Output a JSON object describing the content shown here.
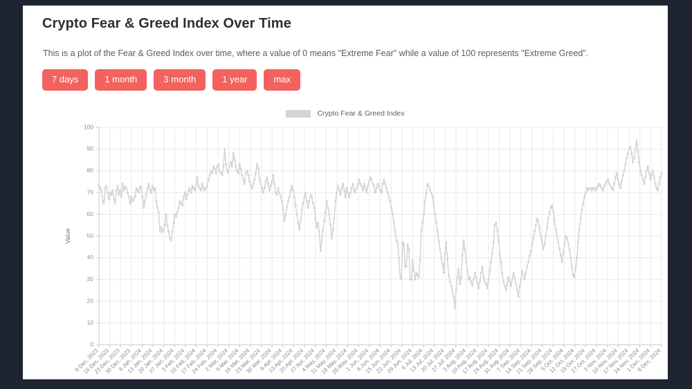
{
  "card": {
    "title": "Crypto Fear & Greed Index Over Time",
    "description": "This is a plot of the Fear & Greed Index over time, where a value of 0 means \"Extreme Fear\" while a value of 100 represents \"Extreme Greed\"."
  },
  "colors": {
    "page_background": "#1e2430",
    "card_background": "#ffffff",
    "button": "#f2635f",
    "button_text": "#ffffff",
    "series": "#d2d2d4",
    "grid": "#e9e9ec"
  },
  "range_buttons": [
    {
      "label": "7 days",
      "name": "range-button-7-days"
    },
    {
      "label": "1 month",
      "name": "range-button-1-month"
    },
    {
      "label": "3 month",
      "name": "range-button-3-month"
    },
    {
      "label": "1 year",
      "name": "range-button-1-year"
    },
    {
      "label": "max",
      "name": "range-button-max"
    }
  ],
  "legend": {
    "label": "Crypto Fear & Greed Index",
    "swatch_color": "#d4d4d4"
  },
  "chart_data": {
    "type": "line",
    "title": "Crypto Fear & Greed Index Over Time",
    "xlabel": "",
    "ylabel": "Value",
    "ylim": [
      0,
      100
    ],
    "yticks": [
      0,
      10,
      20,
      30,
      40,
      50,
      60,
      70,
      80,
      90,
      100
    ],
    "grid": true,
    "legend_position": "top-center",
    "series_name": "Crypto Fear & Greed Index",
    "x_tick_labels": [
      "9 Dec, 2023",
      "16 Dec, 2023",
      "23 Dec, 2023",
      "30 Dec, 2023",
      "6 Jan, 2024",
      "13 Jan, 2024",
      "20 Jan, 2024",
      "27 Jan, 2024",
      "3 Feb, 2024",
      "10 Feb, 2024",
      "17 Feb, 2024",
      "24 Feb, 2024",
      "2 Mar, 2024",
      "9 Mar, 2024",
      "16 Mar, 2024",
      "23 Mar, 2024",
      "30 Mar, 2024",
      "6 Apr, 2024",
      "13 Apr, 2024",
      "20 Apr, 2024",
      "27 Apr, 2024",
      "4 May, 2024",
      "11 May, 2024",
      "18 May, 2024",
      "25 May, 2024",
      "1 Jun, 2024",
      "8 Jun, 2024",
      "15 Jun, 2024",
      "22 Jun, 2024",
      "29 Jun, 2024",
      "6 Jul, 2024",
      "13 Jul, 2024",
      "20 Jul, 2024",
      "27 Jul, 2024",
      "3 Aug, 2024",
      "10 Aug, 2024",
      "17 Aug, 2024",
      "24 Aug, 2024",
      "31 Aug, 2024",
      "7 Sep, 2024",
      "14 Sep, 2024",
      "21 Sep, 2024",
      "28 Sep, 2024",
      "5 Oct, 2024",
      "12 Oct, 2024",
      "19 Oct, 2024",
      "27 Oct, 2024",
      "3 Nov, 2024",
      "10 Nov, 2024",
      "17 Nov, 2024",
      "24 Nov, 2024",
      "1 Dec, 2024",
      "8 Dec, 2024"
    ],
    "x_start": "9 Dec, 2023",
    "x_end": "8 Dec, 2024",
    "values": [
      73,
      72,
      71,
      66,
      65,
      72,
      73,
      70,
      67,
      70,
      69,
      71,
      67,
      65,
      71,
      73,
      69,
      71,
      68,
      74,
      71,
      73,
      72,
      70,
      68,
      65,
      68,
      66,
      67,
      68,
      72,
      71,
      70,
      73,
      72,
      68,
      63,
      66,
      69,
      72,
      74,
      71,
      70,
      73,
      71,
      72,
      66,
      63,
      61,
      52,
      54,
      52,
      53,
      55,
      60,
      55,
      52,
      49,
      48,
      52,
      56,
      60,
      59,
      61,
      63,
      66,
      65,
      64,
      68,
      70,
      67,
      69,
      71,
      72,
      70,
      73,
      72,
      71,
      74,
      77,
      73,
      72,
      71,
      74,
      72,
      71,
      72,
      73,
      76,
      78,
      80,
      79,
      82,
      81,
      79,
      82,
      83,
      80,
      79,
      78,
      82,
      90,
      83,
      80,
      79,
      82,
      84,
      82,
      88,
      85,
      82,
      80,
      79,
      83,
      81,
      78,
      76,
      74,
      79,
      80,
      78,
      75,
      73,
      72,
      74,
      76,
      79,
      83,
      81,
      76,
      74,
      72,
      70,
      72,
      75,
      77,
      74,
      71,
      73,
      75,
      78,
      74,
      70,
      69,
      72,
      70,
      68,
      66,
      62,
      57,
      60,
      63,
      66,
      68,
      71,
      73,
      71,
      68,
      64,
      60,
      56,
      53,
      57,
      62,
      65,
      68,
      70,
      66,
      63,
      66,
      69,
      68,
      65,
      63,
      58,
      54,
      56,
      52,
      43,
      48,
      53,
      57,
      61,
      66,
      63,
      60,
      55,
      49,
      53,
      58,
      66,
      70,
      73,
      71,
      69,
      72,
      74,
      71,
      68,
      72,
      70,
      68,
      70,
      72,
      74,
      71,
      70,
      72,
      74,
      76,
      74,
      73,
      71,
      74,
      72,
      70,
      73,
      75,
      77,
      76,
      74,
      73,
      70,
      72,
      74,
      73,
      71,
      70,
      74,
      76,
      74,
      72,
      70,
      68,
      66,
      63,
      60,
      56,
      52,
      48,
      47,
      40,
      31,
      30,
      47,
      46,
      36,
      36,
      46,
      44,
      30,
      30,
      39,
      34,
      30,
      33,
      32,
      31,
      39,
      52,
      56,
      60,
      66,
      70,
      74,
      73,
      71,
      70,
      68,
      64,
      60,
      56,
      52,
      48,
      44,
      40,
      37,
      33,
      42,
      47,
      39,
      32,
      29,
      27,
      25,
      22,
      17,
      26,
      31,
      35,
      28,
      31,
      41,
      48,
      44,
      38,
      34,
      30,
      31,
      29,
      27,
      30,
      33,
      31,
      28,
      26,
      29,
      33,
      36,
      31,
      29,
      28,
      26,
      30,
      34,
      38,
      42,
      47,
      55,
      56,
      53,
      48,
      42,
      38,
      33,
      29,
      27,
      25,
      28,
      31,
      29,
      27,
      30,
      33,
      31,
      28,
      25,
      22,
      27,
      30,
      34,
      32,
      30,
      33,
      36,
      38,
      41,
      43,
      46,
      49,
      52,
      55,
      58,
      57,
      54,
      50,
      47,
      44,
      46,
      50,
      54,
      58,
      61,
      63,
      64,
      61,
      57,
      53,
      50,
      47,
      44,
      41,
      38,
      42,
      46,
      50,
      49,
      47,
      44,
      40,
      36,
      32,
      31,
      35,
      40,
      47,
      53,
      58,
      62,
      65,
      68,
      70,
      72,
      71,
      72,
      72,
      71,
      72,
      72,
      71,
      72,
      73,
      74,
      73,
      72,
      71,
      73,
      74,
      75,
      76,
      74,
      73,
      72,
      71,
      74,
      77,
      79,
      76,
      74,
      72,
      75,
      78,
      80,
      83,
      86,
      88,
      90,
      91,
      88,
      84,
      86,
      90,
      94,
      89,
      84,
      80,
      78,
      76,
      74,
      77,
      80,
      82,
      79,
      76,
      78,
      80,
      77,
      74,
      72,
      71,
      74,
      77,
      79
    ]
  }
}
